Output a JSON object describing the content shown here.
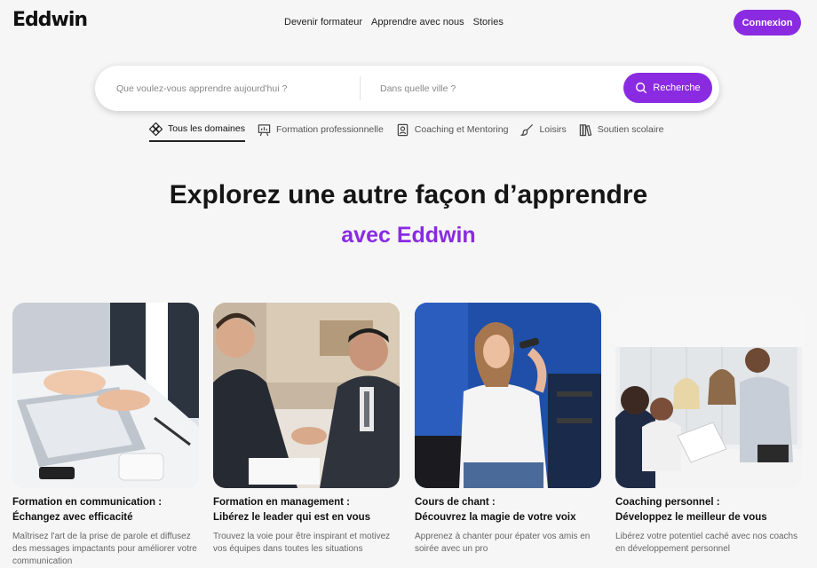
{
  "brand": {
    "logo": "Eddwin",
    "accent": "#8a2be2"
  },
  "nav": {
    "items": [
      "Devenir formateur",
      "Apprendre avec nous",
      "Stories"
    ],
    "login_label": "Connexion"
  },
  "search": {
    "query_placeholder": "Que voulez-vous apprendre aujourd'hui ?",
    "city_placeholder": "Dans quelle ville ?",
    "button_label": "Recherche"
  },
  "categories": [
    {
      "label": "Tous les domaines",
      "icon": "domains-icon",
      "active": true
    },
    {
      "label": "Formation professionnelle",
      "icon": "presentation-icon",
      "active": false
    },
    {
      "label": "Coaching et Mentoring",
      "icon": "badge-icon",
      "active": false
    },
    {
      "label": "Loisirs",
      "icon": "brush-icon",
      "active": false
    },
    {
      "label": "Soutien scolaire",
      "icon": "books-icon",
      "active": false
    }
  ],
  "hero": {
    "title": "Explorez une autre façon d’apprendre",
    "subtitle": "avec Eddwin"
  },
  "cards": [
    {
      "title_line1": "Formation en communication :",
      "title_line2": "Échangez avec efficacité",
      "description": "Maîtrisez l'art de la prise de parole et diffusez des messages impactants pour améliorer votre communication",
      "image": "laptop-typing-photo"
    },
    {
      "title_line1": "Formation en management :",
      "title_line2": "Libérez le leader qui est en vous",
      "description": "Trouvez la voie pour être inspirant et motivez vos équipes dans toutes les situations",
      "image": "handshake-photo"
    },
    {
      "title_line1": "Cours de chant :",
      "title_line2": "Découvrez la magie de votre voix",
      "description": "Apprenez à chanter pour épater vos amis en soirée avec un pro",
      "image": "singer-microphone-photo"
    },
    {
      "title_line1": "Coaching personnel :",
      "title_line2": "Développez le meilleur de vous",
      "description": "Libérez votre potentiel caché avec nos coachs en développement personnel",
      "image": "team-meeting-photo"
    }
  ]
}
